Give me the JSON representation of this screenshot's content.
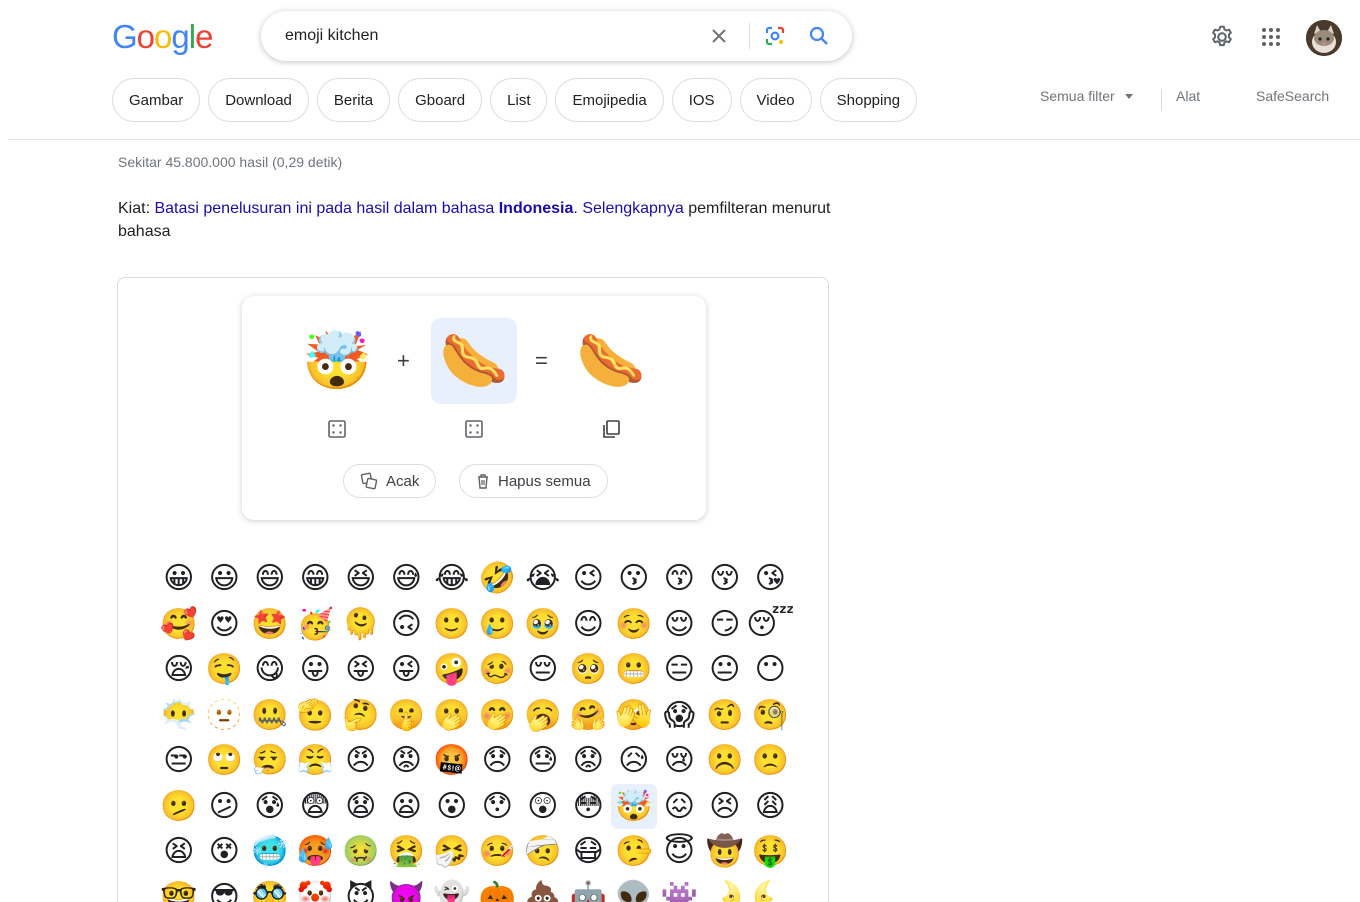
{
  "header": {
    "logo": "Google",
    "logo_colors": [
      "#4285F4",
      "#EA4335",
      "#FBBC05",
      "#4285F4",
      "#34A853",
      "#EA4335"
    ],
    "search_value": "emoji kitchen",
    "icons": {
      "clear": "close-icon",
      "lens": "google-lens-icon",
      "search": "search-icon",
      "settings": "gear-icon",
      "apps": "apps-grid-icon"
    }
  },
  "chips": [
    "Gambar",
    "Download",
    "Berita",
    "Gboard",
    "List",
    "Emojipedia",
    "IOS",
    "Video",
    "Shopping"
  ],
  "filters": {
    "all_filters": "Semua filter",
    "tools": "Alat",
    "safesearch": "SafeSearch"
  },
  "results": {
    "stats": "Sekitar 45.800.000 hasil (0,29 detik)",
    "tip": {
      "label": "Kiat:",
      "link1": "Batasi penelusuran ini pada hasil dalam bahasa",
      "lang": "Indonesia",
      "dot": ".",
      "link2": "Selengkapnya",
      "rest": "pemfilteran menurut bahasa"
    }
  },
  "kitchen": {
    "first_emoji": "🤯",
    "plus": "+",
    "second_emoji": "🌭",
    "equals": "=",
    "result_emoji": "🌭",
    "random_label": "Acak",
    "clear_label": "Hapus semua",
    "selected_index": 80,
    "emoji_grid": [
      "😀",
      "😃",
      "😄",
      "😁",
      "😆",
      "😅",
      "😂",
      "🤣",
      "😭",
      "😉",
      "😗",
      "😙",
      "😚",
      "😘",
      "🥰",
      "😍",
      "🤩",
      "🥳",
      "🫠",
      "🙃",
      "🙂",
      "🥲",
      "🥹",
      "😊",
      "☺️",
      "😌",
      "😏",
      "😴",
      "😪",
      "🤤",
      "😋",
      "😛",
      "😝",
      "😜",
      "🤪",
      "🥴",
      "😔",
      "🥺",
      "😬",
      "😑",
      "😐",
      "😶",
      "😶‍🌫️",
      "🫥",
      "🤐",
      "🫡",
      "🤔",
      "🤫",
      "🫢",
      "🤭",
      "🥱",
      "🤗",
      "🫣",
      "😱",
      "🤨",
      "🧐",
      "😒",
      "🙄",
      "😮‍💨",
      "😤",
      "😠",
      "😡",
      "🤬",
      "😞",
      "😓",
      "😟",
      "😥",
      "😢",
      "☹️",
      "🙁",
      "🫤",
      "😕",
      "😰",
      "😨",
      "😧",
      "😦",
      "😮",
      "😯",
      "😲",
      "😳",
      "🤯",
      "😖",
      "😣",
      "😩",
      "😫",
      "😵",
      "🥶",
      "🥵",
      "🤢",
      "🤮",
      "🤧",
      "🤒",
      "🤕",
      "😷",
      "🤥",
      "😇",
      "🤠",
      "🤑",
      "🤓",
      "😎",
      "🥸",
      "🤡",
      "😈",
      "👿",
      "👻",
      "🎃",
      "💩",
      "🤖",
      "👽",
      "👾",
      "🌛",
      "🌜"
    ]
  }
}
